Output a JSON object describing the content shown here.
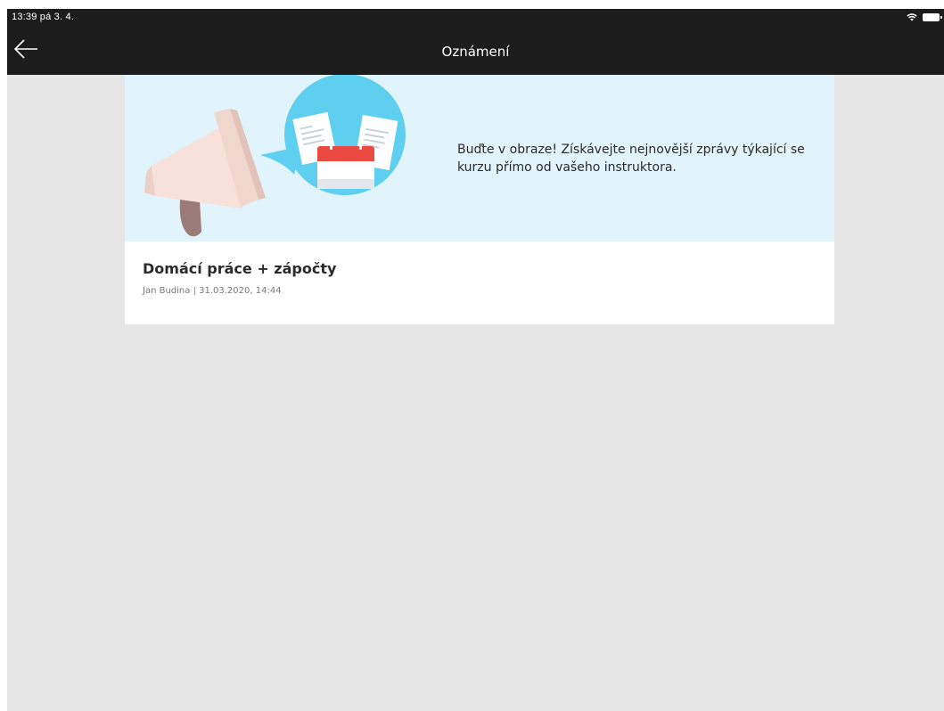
{
  "status_bar": {
    "time": "13:39  pá 3. 4.",
    "icons": [
      "wifi-icon",
      "battery-icon"
    ]
  },
  "nav": {
    "title": "Oznámení",
    "back_icon": "arrow-left-icon"
  },
  "hero": {
    "message": "Buďte v obraze! Získávejte nejnovější zprávy týkající se kurzu přímo od vašeho instruktora.",
    "illustration_icons": [
      "megaphone-icon",
      "calendar-icon",
      "document-icon"
    ],
    "colors": {
      "background": "#e1f3fb",
      "bubble": "#5fcff0",
      "calendar_red": "#ea4a3f",
      "megaphone": "#f7e1da",
      "handle": "#9b7b75"
    }
  },
  "announcements": [
    {
      "title": "Domácí práce + zápočty",
      "author": "Jan Budina",
      "separator": " | ",
      "date": "31.03.2020, 14:44"
    }
  ],
  "colors": {
    "topbar": "#1c1c1c",
    "page_background": "#e6e6e6",
    "card": "#ffffff"
  }
}
